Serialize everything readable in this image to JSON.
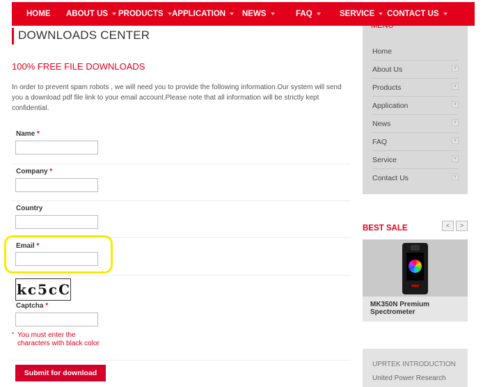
{
  "nav": {
    "items": [
      {
        "label": "HOME"
      },
      {
        "label": "ABOUT US"
      },
      {
        "label": "PRODUCTS"
      },
      {
        "label": "APPLICATION"
      },
      {
        "label": "NEWS"
      },
      {
        "label": "FAQ"
      },
      {
        "label": "SERVICE"
      },
      {
        "label": "CONTACT US"
      }
    ]
  },
  "main": {
    "title": "DOWNLOADS CENTER",
    "subtitle": "100% FREE FILE DOWNLOADS",
    "intro": "In order to prevent spam robots , we will need you to provide the following information.Our system will send you a download pdf file link to your email account.Please note that all information will be strictly kept confidential."
  },
  "form": {
    "name_label": "Name",
    "company_label": "Company",
    "country_label": "Country",
    "email_label": "Email",
    "captcha_label": "Captcha",
    "required_mark": "*",
    "captcha_image_text": "kc5cC",
    "captcha_note_mark": "*",
    "captcha_note": "You must enter the characters with black color",
    "submit_label": "Submit for download"
  },
  "sidebar": {
    "menu_title": "MENU",
    "menu_items": [
      {
        "label": "Home"
      },
      {
        "label": "About Us"
      },
      {
        "label": "Products"
      },
      {
        "label": "Application"
      },
      {
        "label": "News"
      },
      {
        "label": "FAQ"
      },
      {
        "label": "Service"
      },
      {
        "label": "Contact Us"
      }
    ],
    "best_sale_title": "BEST SALE",
    "prev_arrow": "<",
    "next_arrow": ">",
    "product_name": "MK350N Premium Spectrometer",
    "uprtek_title": "UPRTEK INTRODUCTION",
    "uprtek_item": "United Power Research"
  },
  "colors": {
    "brand_red": "#e3001b",
    "highlight_yellow": "#f5ec00",
    "sidebar_gray": "#d9d9d9"
  }
}
